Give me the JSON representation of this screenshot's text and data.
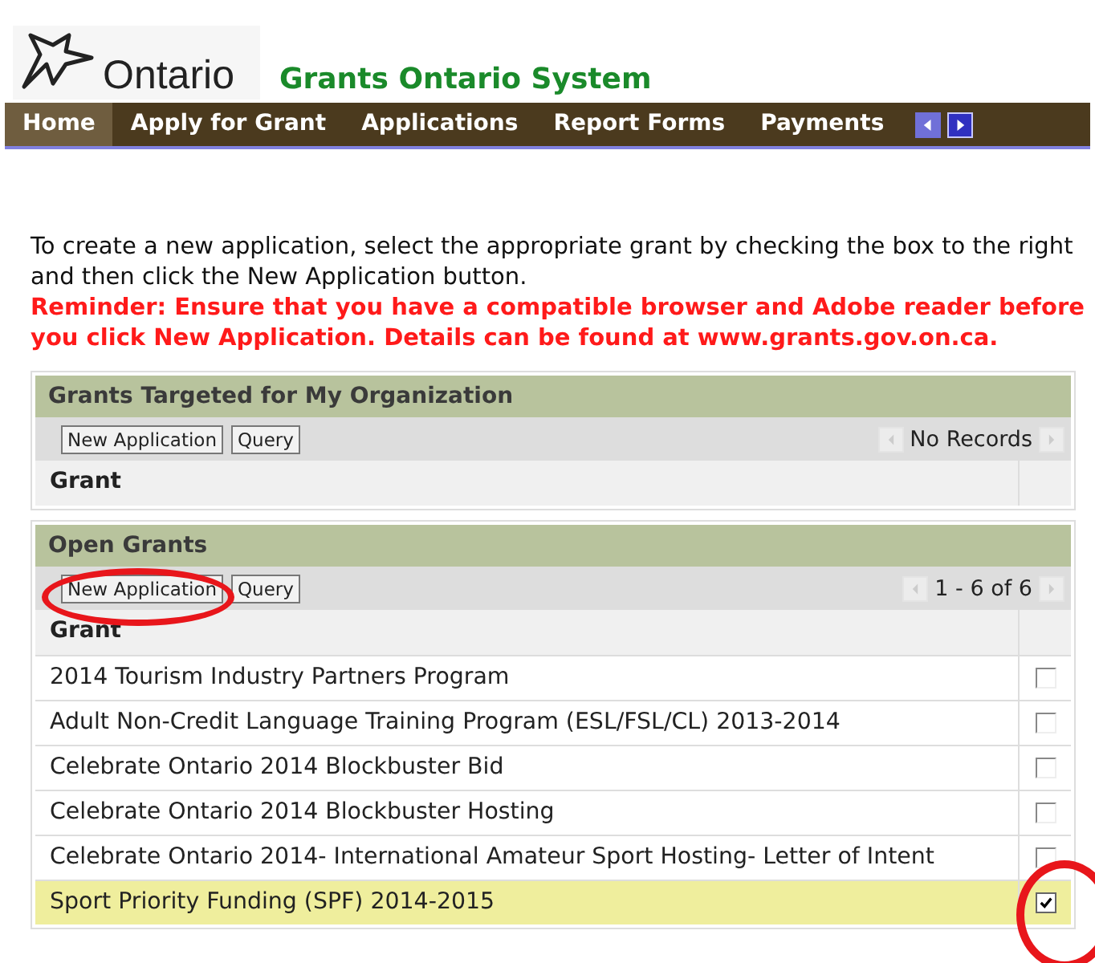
{
  "header": {
    "logo_text": "Ontario",
    "system_title": "Grants Ontario System"
  },
  "nav": {
    "tabs": [
      {
        "label": "Home",
        "selected": true
      },
      {
        "label": "Apply for Grant",
        "selected": false
      },
      {
        "label": "Applications",
        "selected": false
      },
      {
        "label": "Report Forms",
        "selected": false
      },
      {
        "label": "Payments",
        "selected": false
      }
    ],
    "prev_disabled": true,
    "next_disabled": false
  },
  "intro": {
    "text": "To create a new application, select the appropriate grant by checking the box to the right and then click the New Application button.",
    "reminder": "Reminder: Ensure that you have a compatible browser and Adobe reader before you click New Application. Details can be found at www.grants.gov.on.ca."
  },
  "panels": [
    {
      "title": "Grants Targeted for My Organization",
      "buttons": [
        "New Application",
        "Query"
      ],
      "pager": "No Records",
      "column": "Grant",
      "annotated": false
    },
    {
      "title": "Open Grants",
      "buttons": [
        "New Application",
        "Query"
      ],
      "pager": "1 - 6 of 6",
      "column": "Grant",
      "annotated": true,
      "rows": [
        {
          "name": "2014 Tourism Industry Partners Program",
          "checked": false,
          "selected": false
        },
        {
          "name": "Adult Non-Credit Language Training Program (ESL/FSL/CL) 2013-2014",
          "checked": false,
          "selected": false
        },
        {
          "name": "Celebrate Ontario 2014 Blockbuster Bid",
          "checked": false,
          "selected": false
        },
        {
          "name": "Celebrate Ontario 2014 Blockbuster Hosting",
          "checked": false,
          "selected": false
        },
        {
          "name": "Celebrate Ontario 2014- International Amateur Sport Hosting- Letter of Intent",
          "checked": false,
          "selected": false
        },
        {
          "name": "Sport Priority Funding (SPF) 2014-2015",
          "checked": true,
          "selected": true
        }
      ]
    }
  ]
}
